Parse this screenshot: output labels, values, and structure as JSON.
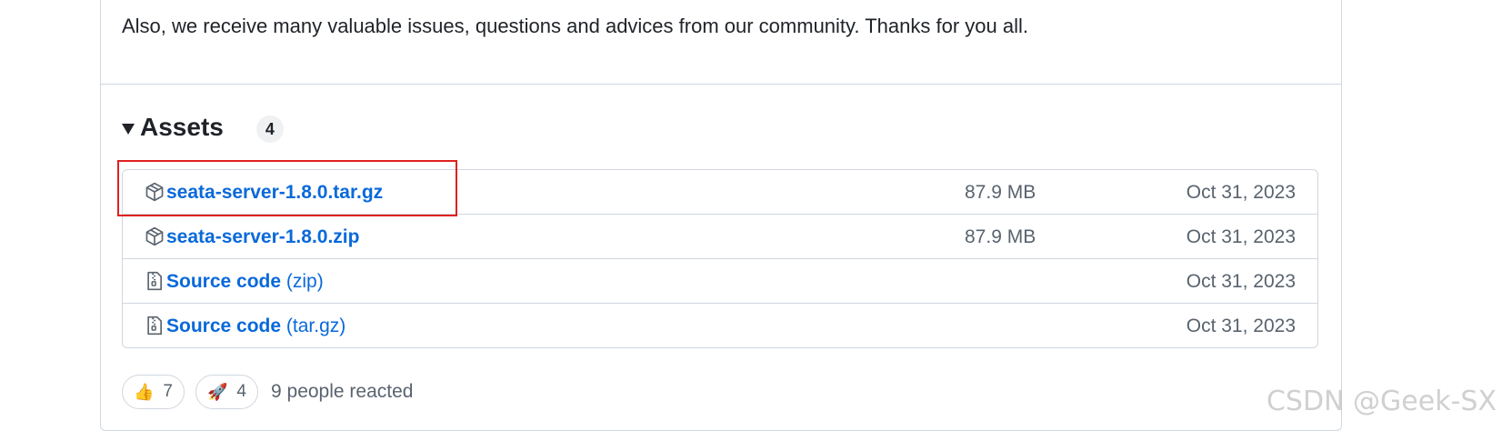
{
  "release": {
    "body_text": "Also, we receive many valuable issues, questions and advices from our community. Thanks for you all."
  },
  "assets": {
    "title": "Assets",
    "count": "4",
    "items": [
      {
        "name": "seata-server-1.8.0.tar.gz",
        "suffix": "",
        "size": "87.9 MB",
        "date": "Oct 31, 2023",
        "icon": "package-icon"
      },
      {
        "name": "seata-server-1.8.0.zip",
        "suffix": "",
        "size": "87.9 MB",
        "date": "Oct 31, 2023",
        "icon": "package-icon"
      },
      {
        "name": "Source code",
        "suffix": "(zip)",
        "size": "",
        "date": "Oct 31, 2023",
        "icon": "file-zip-icon"
      },
      {
        "name": "Source code",
        "suffix": "(tar.gz)",
        "size": "",
        "date": "Oct 31, 2023",
        "icon": "file-zip-icon"
      }
    ]
  },
  "reactions": {
    "items": [
      {
        "emoji": "👍",
        "count": "7",
        "icon": "thumbs-up-icon"
      },
      {
        "emoji": "🚀",
        "count": "4",
        "icon": "rocket-icon"
      }
    ],
    "summary": "9 people reacted"
  },
  "watermark": "CSDN @Geek-SX",
  "colors": {
    "link": "#0969da",
    "highlight": "#e02020",
    "border": "#d0d7de",
    "muted": "#59636e"
  }
}
